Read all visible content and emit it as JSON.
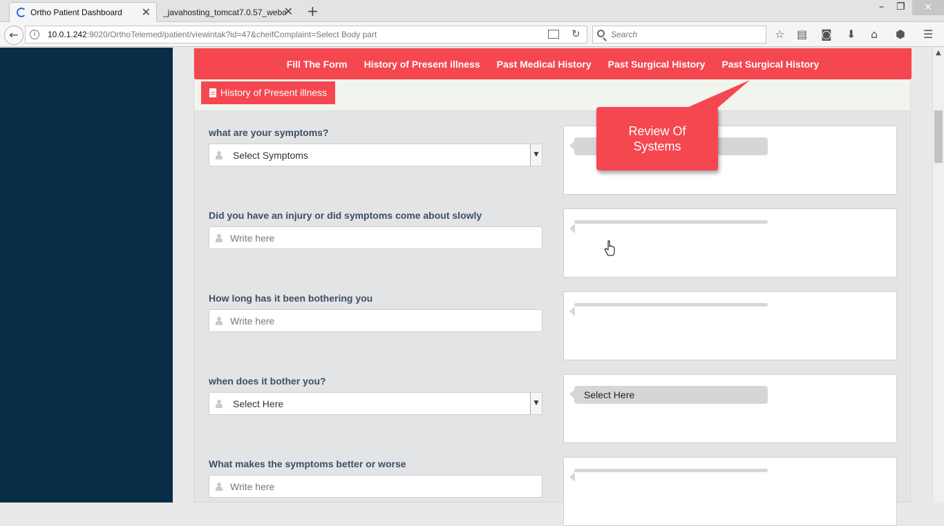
{
  "browser": {
    "tabs": [
      {
        "title": "Ortho Patient Dashboard",
        "active": true
      },
      {
        "title": "_javahosting_tomcat7.0.57_weba",
        "active": false
      }
    ],
    "url_host": "10.0.1.242",
    "url_rest": ":9020/OrthoTelemed/patient/viewintak?id=47&cheifComplaint=Select Body part",
    "search_placeholder": "Search"
  },
  "nav": {
    "links": [
      "Fill The Form",
      "History of Present illness",
      "Past Medical History",
      "Past Surgical History",
      "Past Surgical History"
    ]
  },
  "section": {
    "title": "History of Present illness"
  },
  "questions": [
    {
      "label": "what are your symptoms?",
      "type": "select",
      "value": "Select Symptoms",
      "answer": ""
    },
    {
      "label": "Did you have an injury or did symptoms come about slowly",
      "type": "text",
      "placeholder": "Write here",
      "answer": ""
    },
    {
      "label": "How long has it been bothering you",
      "type": "text",
      "placeholder": "Write here",
      "answer": ""
    },
    {
      "label": "when does it bother you?",
      "type": "select",
      "value": "Select Here",
      "answer": "Select Here"
    },
    {
      "label": "What makes the symptoms better or worse",
      "type": "text",
      "placeholder": "Write here",
      "answer": ""
    }
  ],
  "callout": {
    "text": "Review Of Systems",
    "color": "#f5474f"
  },
  "colors": {
    "sidebar": "#0a2d47",
    "accent": "#f5474f",
    "label": "#3d4e66"
  }
}
